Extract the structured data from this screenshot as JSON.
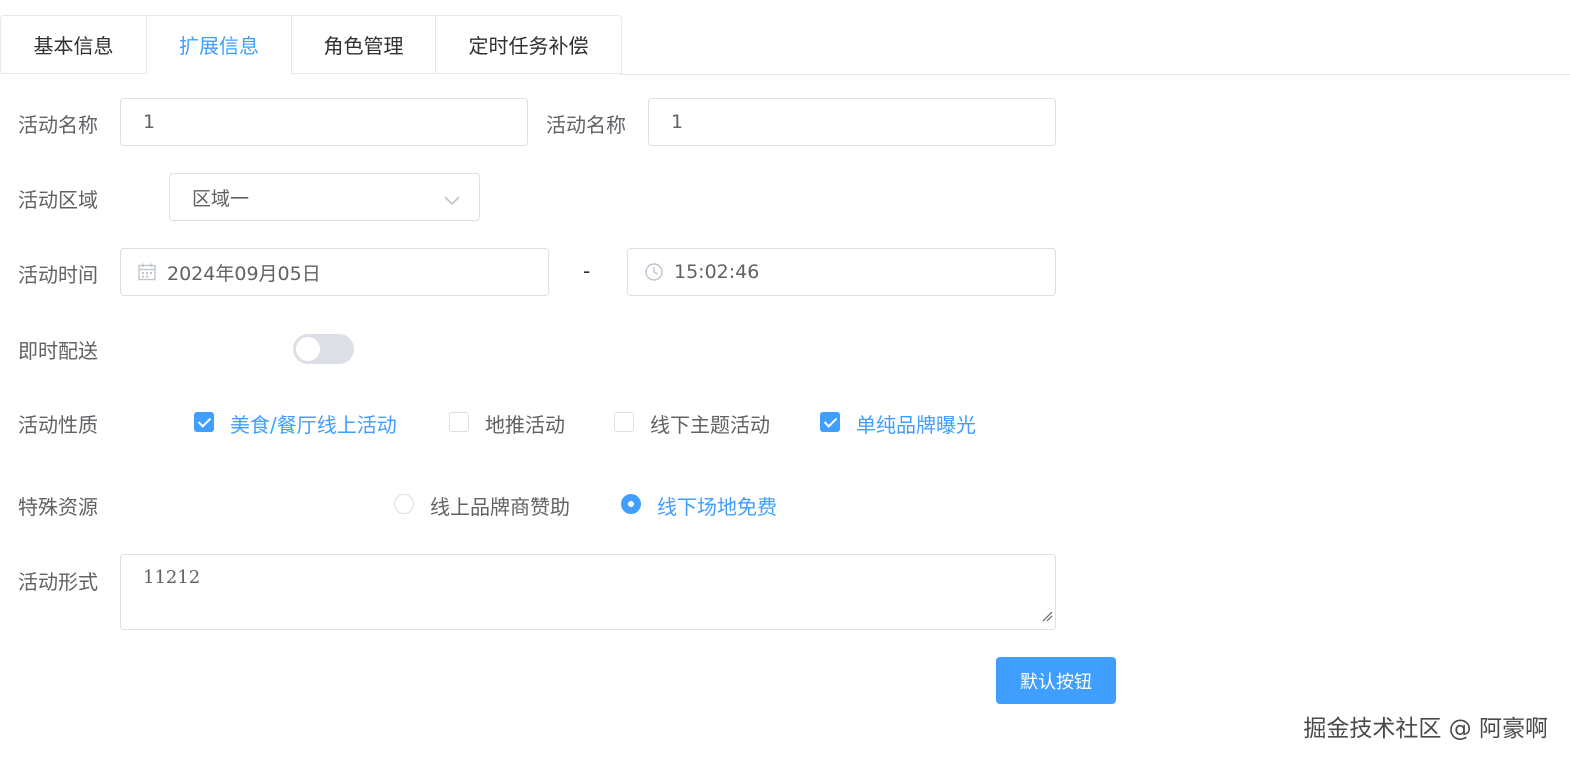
{
  "tabs": [
    {
      "label": "基本信息",
      "active": false
    },
    {
      "label": "扩展信息",
      "active": true
    },
    {
      "label": "角色管理",
      "active": false
    },
    {
      "label": "定时任务补偿",
      "active": false
    }
  ],
  "form": {
    "name_label_1": "活动名称",
    "name_value_1": "1",
    "name_label_2": "活动名称",
    "name_value_2": "1",
    "region_label": "活动区域",
    "region_value": "区域一",
    "time_label": "活动时间",
    "date_value": "2024年09月05日",
    "time_separator": "-",
    "time_value": "15:02:46",
    "delivery_label": "即时配送",
    "delivery_on": false,
    "type_label": "活动性质",
    "type_options": [
      {
        "label": "美食/餐厅线上活动",
        "checked": true
      },
      {
        "label": "地推活动",
        "checked": false
      },
      {
        "label": "线下主题活动",
        "checked": false
      },
      {
        "label": "单纯品牌曝光",
        "checked": true
      }
    ],
    "resource_label": "特殊资源",
    "resource_options": [
      {
        "label": "线上品牌商赞助",
        "selected": false
      },
      {
        "label": "线下场地免费",
        "selected": true
      }
    ],
    "form_label": "活动形式",
    "form_value": "11212",
    "submit_label": "默认按钮"
  },
  "watermark": "掘金技术社区 @ 阿豪啊",
  "colors": {
    "accent": "#409eff",
    "border": "#dcdfe6",
    "text": "#606266"
  }
}
